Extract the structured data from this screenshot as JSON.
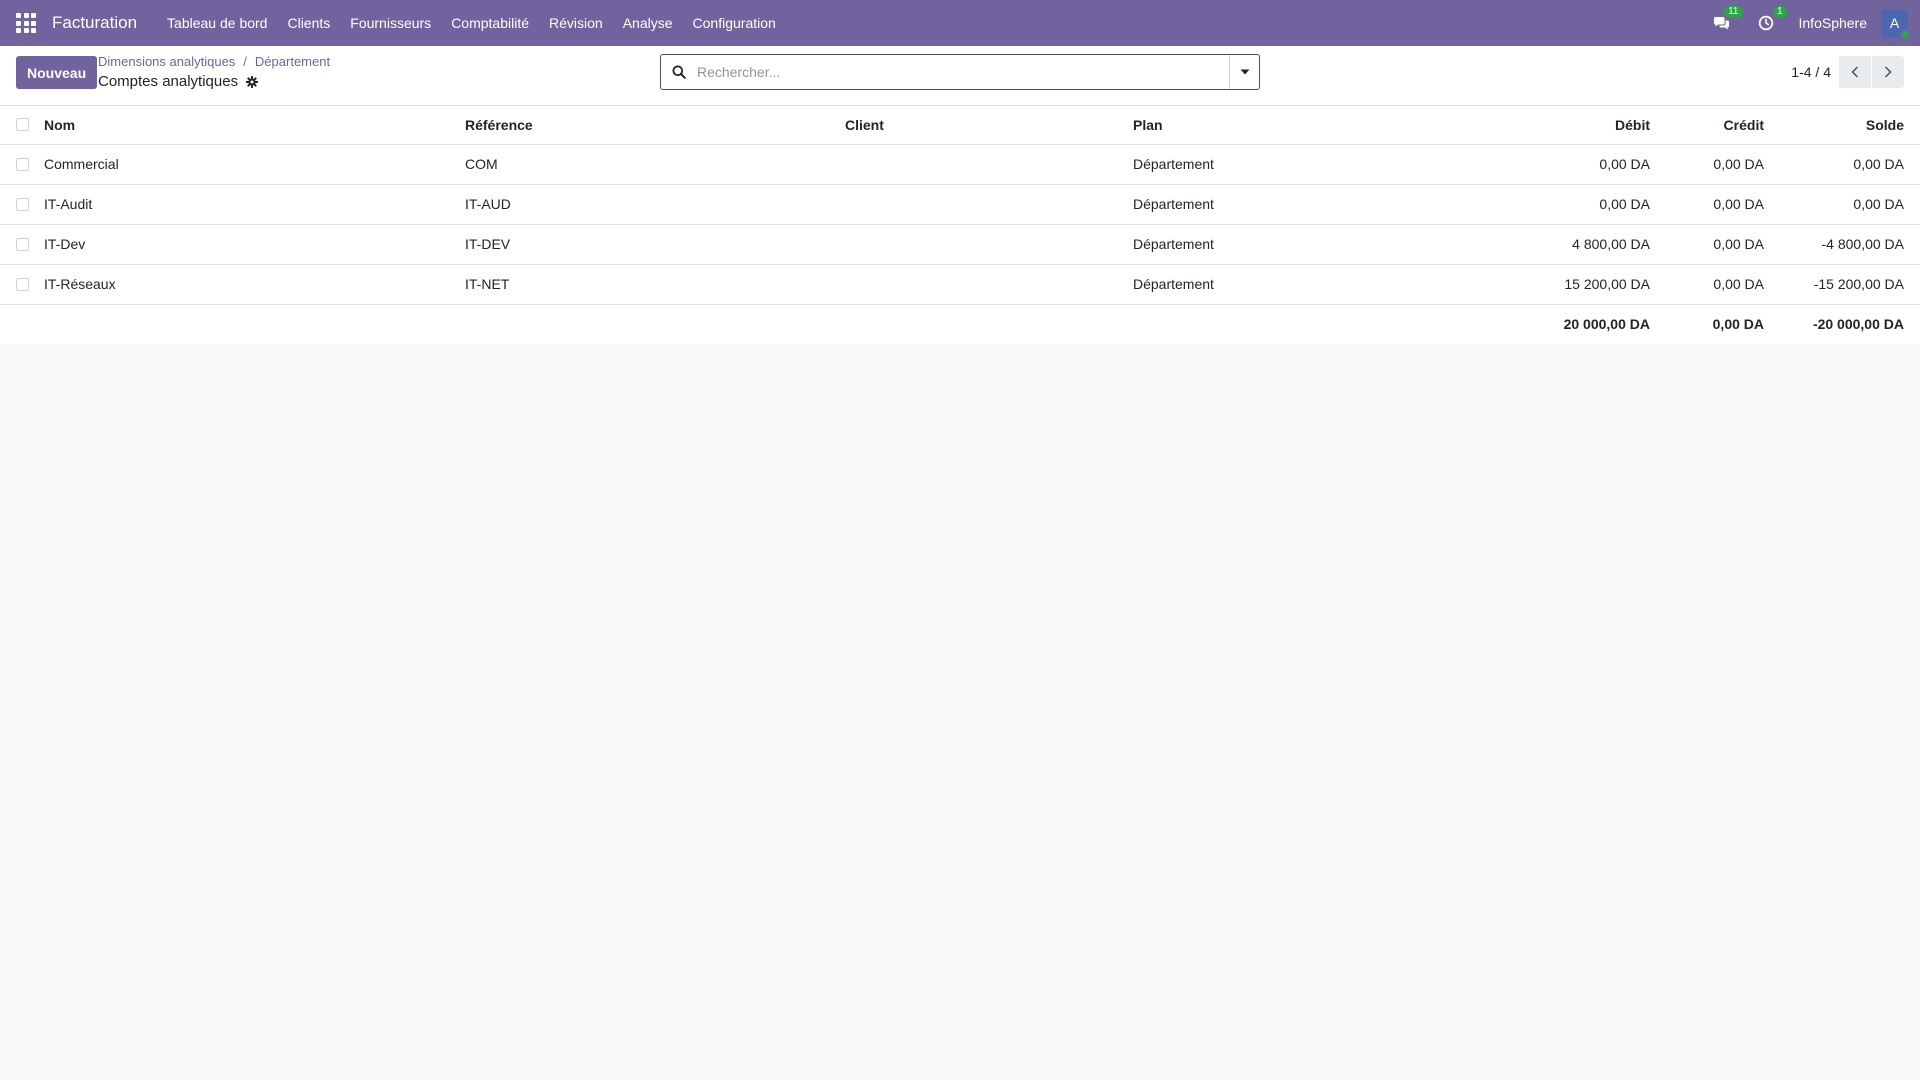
{
  "navbar": {
    "app_name": "Facturation",
    "menu": [
      "Tableau de bord",
      "Clients",
      "Fournisseurs",
      "Comptabilité",
      "Révision",
      "Analyse",
      "Configuration"
    ],
    "messages_count": "11",
    "activities_count": "1",
    "company": "InfoSphere",
    "avatar_letter": "A"
  },
  "control": {
    "new_label": "Nouveau",
    "breadcrumb": [
      "Dimensions analytiques",
      "Département"
    ],
    "title": "Comptes analytiques",
    "search_placeholder": "Rechercher...",
    "pager": "1-4 / 4"
  },
  "table": {
    "headers": {
      "name": "Nom",
      "reference": "Référence",
      "client": "Client",
      "plan": "Plan",
      "debit": "Débit",
      "credit": "Crédit",
      "balance": "Solde"
    },
    "rows": [
      {
        "name": "Commercial",
        "reference": "COM",
        "client": "",
        "plan": "Département",
        "debit": "0,00 DA",
        "credit": "0,00 DA",
        "balance": "0,00 DA"
      },
      {
        "name": "IT-Audit",
        "reference": "IT-AUD",
        "client": "",
        "plan": "Département",
        "debit": "0,00 DA",
        "credit": "0,00 DA",
        "balance": "0,00 DA"
      },
      {
        "name": "IT-Dev",
        "reference": "IT-DEV",
        "client": "",
        "plan": "Département",
        "debit": "4 800,00 DA",
        "credit": "0,00 DA",
        "balance": "-4 800,00 DA"
      },
      {
        "name": "IT-Réseaux",
        "reference": "IT-NET",
        "client": "",
        "plan": "Département",
        "debit": "15 200,00 DA",
        "credit": "0,00 DA",
        "balance": "-15 200,00 DA"
      }
    ],
    "totals": {
      "debit": "20 000,00 DA",
      "credit": "0,00 DA",
      "balance": "-20 000,00 DA"
    }
  },
  "colors": {
    "brand": "#71639e"
  }
}
